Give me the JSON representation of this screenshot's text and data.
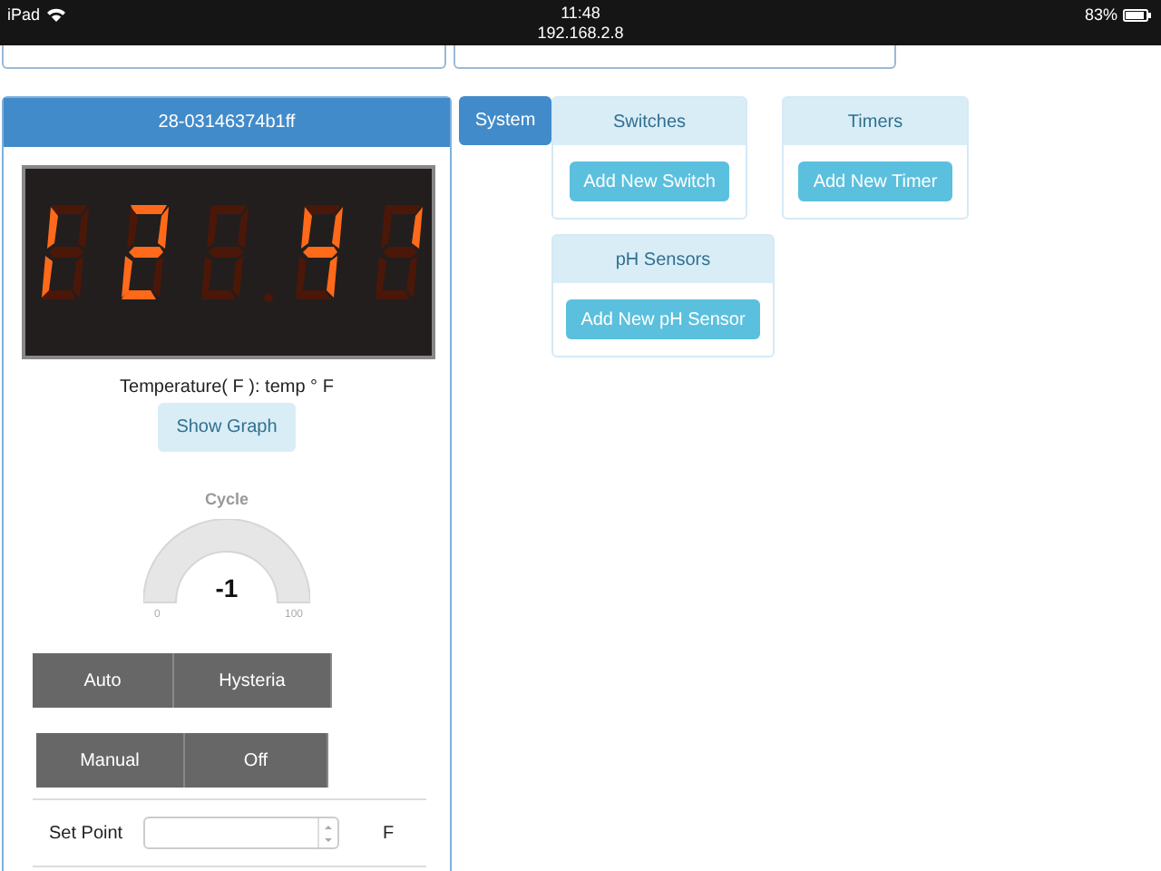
{
  "status_bar": {
    "device": "iPad",
    "time": "11:48",
    "address": "192.168.2.8",
    "battery": "83%"
  },
  "sensor_panel": {
    "title": "28-03146374b1ff",
    "reading_label": "Temperature( F ): temp ° F",
    "graph_button": "Show Graph",
    "gauge": {
      "title": "Cycle",
      "value": "-1",
      "min": "0",
      "max": "100"
    },
    "mode_groups": [
      {
        "buttons": [
          "Auto",
          "Hysteria"
        ]
      },
      {
        "buttons": [
          "Manual",
          "Off"
        ]
      }
    ],
    "set_point": {
      "label": "Set Point",
      "unit": "F"
    }
  },
  "system_tab": {
    "label": "System",
    "selected": true
  },
  "cards": [
    {
      "title": "Switches",
      "button": "Add New Switch"
    },
    {
      "title": "Timers",
      "button": "Add New Timer"
    },
    {
      "title": "pH Sensors",
      "button": "Add New pH Sensor"
    }
  ]
}
